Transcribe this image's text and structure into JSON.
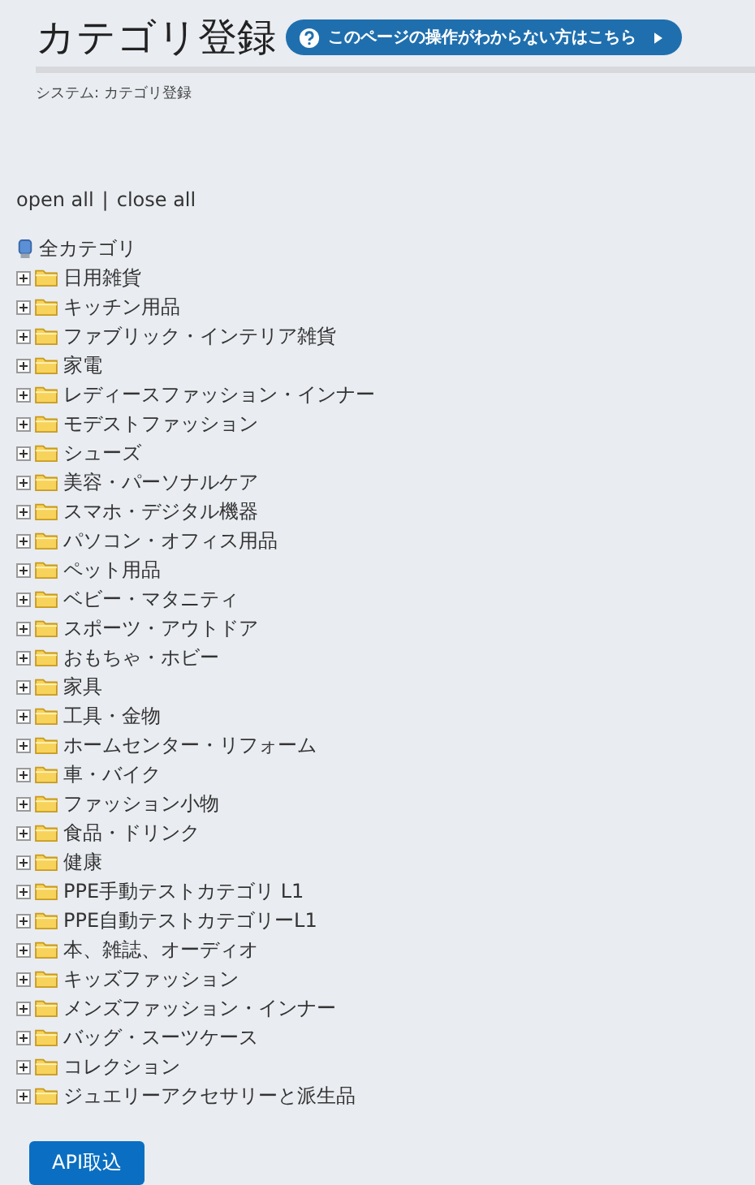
{
  "header": {
    "title": "カテゴリ登録",
    "help_button": "このページの操作がわからない方はこちら",
    "breadcrumb": "システム: カテゴリ登録"
  },
  "tree_controls": {
    "links": [
      "open all",
      "close all"
    ],
    "separator": "|"
  },
  "tree": {
    "label": "全カテゴリ",
    "children": [
      {
        "label": "日用雑貨",
        "expanded": false
      },
      {
        "label": "キッチン用品",
        "expanded": false
      },
      {
        "label": "ファブリック・インテリア雑貨",
        "expanded": false
      },
      {
        "label": "家電",
        "expanded": false
      },
      {
        "label": "レディースファッション・インナー",
        "expanded": false
      },
      {
        "label": "モデストファッション",
        "expanded": false
      },
      {
        "label": "シューズ",
        "expanded": false
      },
      {
        "label": "美容・パーソナルケア",
        "expanded": false
      },
      {
        "label": "スマホ・デジタル機器",
        "expanded": false
      },
      {
        "label": "パソコン・オフィス用品",
        "expanded": false
      },
      {
        "label": "ペット用品",
        "expanded": false
      },
      {
        "label": "ベビー・マタニティ",
        "expanded": false
      },
      {
        "label": "スポーツ・アウトドア",
        "expanded": false
      },
      {
        "label": "おもちゃ・ホビー",
        "expanded": false
      },
      {
        "label": "家具",
        "expanded": false
      },
      {
        "label": "工具・金物",
        "expanded": false
      },
      {
        "label": "ホームセンター・リフォーム",
        "expanded": false
      },
      {
        "label": "車・バイク",
        "expanded": false
      },
      {
        "label": "ファッション小物",
        "expanded": false
      },
      {
        "label": "食品・ドリンク",
        "expanded": false
      },
      {
        "label": "健康",
        "expanded": false
      },
      {
        "label": "PPE手動テストカテゴリ L1",
        "expanded": false
      },
      {
        "label": "PPE自動テストカテゴリーL1",
        "expanded": false
      },
      {
        "label": "本、雑誌、オーディオ",
        "expanded": false
      },
      {
        "label": "キッズファッション",
        "expanded": false
      },
      {
        "label": "メンズファッション・インナー",
        "expanded": false
      },
      {
        "label": "バッグ・スーツケース",
        "expanded": false
      },
      {
        "label": "コレクション",
        "expanded": false
      },
      {
        "label": "ジュエリーアクセサリーと派生品",
        "expanded": false
      }
    ]
  },
  "buttons": [
    "API取込"
  ]
}
